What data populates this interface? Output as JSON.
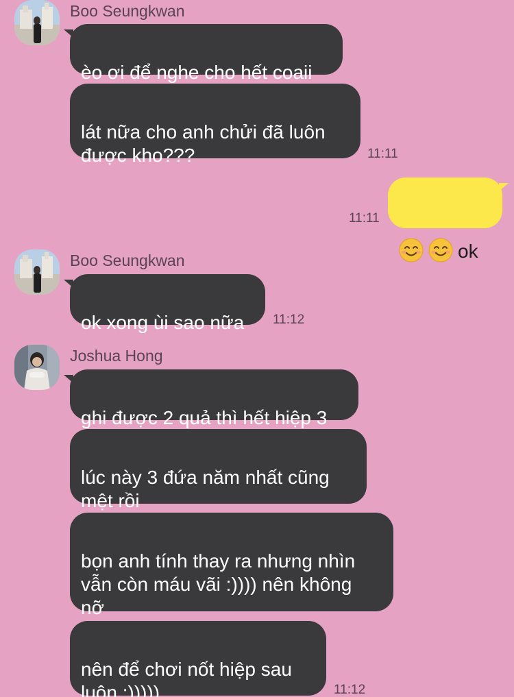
{
  "messages": [
    {
      "sender": "Boo Seungkwan"
    },
    {
      "text": "èo ơi để nghe cho hết coaii"
    },
    {
      "text": "lát nữa cho anh chửi đã luôn\nđược kho???",
      "time": "11:11"
    },
    {
      "me": true,
      "emoji": [
        "smiling-face-icon",
        "smiling-face-icon"
      ],
      "text": "ok",
      "time": "11:11"
    },
    {
      "sender": "Boo Seungkwan"
    },
    {
      "text": "ok xong ùi sao nữa",
      "time": "11:12"
    },
    {
      "sender": "Joshua Hong"
    },
    {
      "text": "ghi được 2 quả thì hết hiệp 3"
    },
    {
      "text": "lúc này 3 đứa năm nhất cũng\nmệt rồi"
    },
    {
      "text": "bọn anh tính thay ra nhưng nhìn\nvẫn còn máu vãi :)))) nên không\nnỡ"
    },
    {
      "text": "nên để chơi nốt hiệp sau\nluôn :)))))",
      "time": "11:12"
    }
  ],
  "colors": {
    "background": "#e6a2c3",
    "incoming_bubble": "#3a3a3c",
    "outgoing_bubble": "#fce84b",
    "meta_text": "#5a4356"
  }
}
